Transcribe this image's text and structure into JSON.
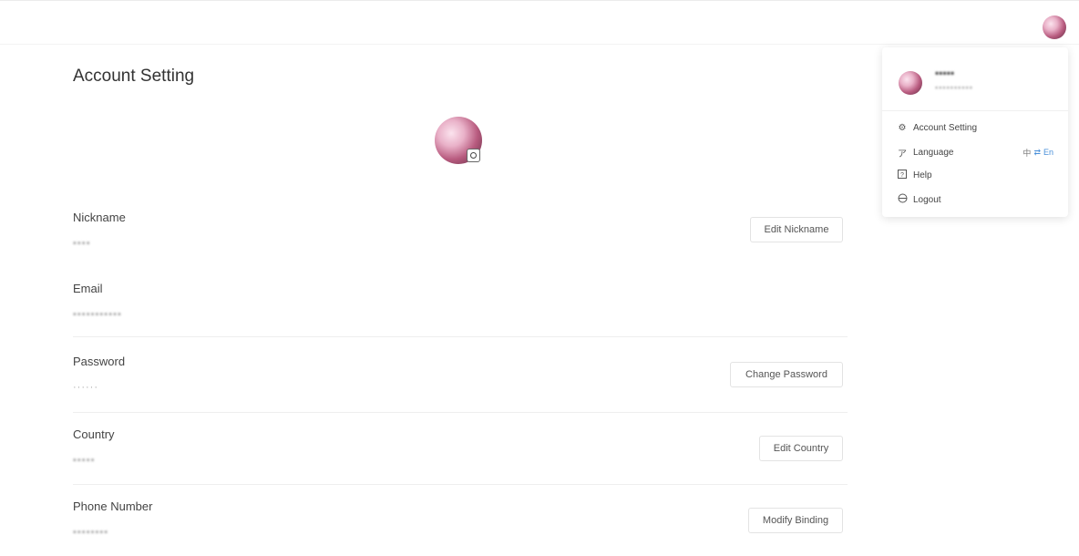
{
  "header": {
    "avatar_icon": "user-avatar-icon"
  },
  "page": {
    "title": "Account Setting"
  },
  "fields": {
    "nickname": {
      "label": "Nickname",
      "value": "▪▪▪▪",
      "button": "Edit Nickname"
    },
    "email": {
      "label": "Email",
      "value": "▪▪▪▪▪▪▪▪▪▪▪"
    },
    "password": {
      "label": "Password",
      "value": "······",
      "button": "Change Password"
    },
    "country": {
      "label": "Country",
      "value": "▪▪▪▪▪",
      "button": "Edit Country"
    },
    "phone": {
      "label": "Phone Number",
      "value": "▪▪▪▪▪▪▪▪",
      "button": "Modify Binding"
    }
  },
  "menu": {
    "username": "▪▪▪▪▪",
    "email": "▪▪▪▪▪▪▪▪▪▪",
    "items": [
      {
        "label": "Account Setting",
        "icon": "settings-icon"
      },
      {
        "label": "Language",
        "icon": "translate-icon"
      },
      {
        "label": "Help",
        "icon": "help-icon"
      },
      {
        "label": "Logout",
        "icon": "logout-icon"
      }
    ],
    "language": {
      "cn": "中",
      "sep": "⇄",
      "en": "En"
    }
  }
}
